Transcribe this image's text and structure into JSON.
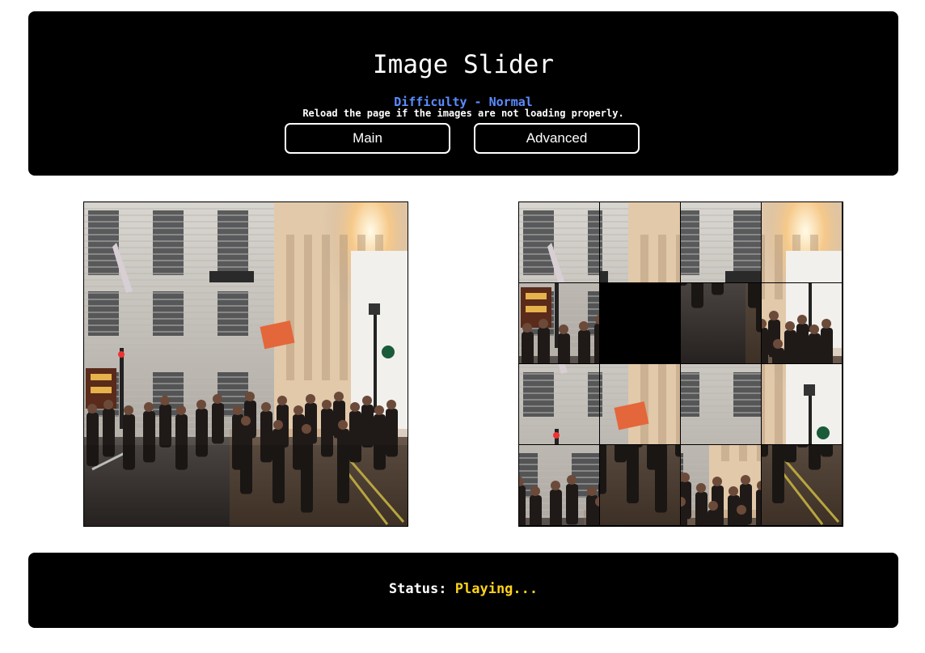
{
  "header": {
    "title": "Image Slider",
    "difficulty": "Difficulty - Normal",
    "reload_note": "Reload the page if the images are not loading properly.",
    "buttons": {
      "main": "Main",
      "advanced": "Advanced"
    }
  },
  "reference_image": {
    "alt": "street-photo"
  },
  "puzzle": {
    "grid_size": 4,
    "empty_tile": 5,
    "tiles": [
      {
        "slot": 0,
        "piece": 0
      },
      {
        "slot": 1,
        "piece": 2
      },
      {
        "slot": 2,
        "piece": 1
      },
      {
        "slot": 3,
        "piece": 3
      },
      {
        "slot": 4,
        "piece": 8
      },
      {
        "slot": 5,
        "piece": null
      },
      {
        "slot": 6,
        "piece": 13
      },
      {
        "slot": 7,
        "piece": 11
      },
      {
        "slot": 8,
        "piece": 4
      },
      {
        "slot": 9,
        "piece": 6
      },
      {
        "slot": 10,
        "piece": 5
      },
      {
        "slot": 11,
        "piece": 7
      },
      {
        "slot": 12,
        "piece": 9
      },
      {
        "slot": 13,
        "piece": 14
      },
      {
        "slot": 14,
        "piece": 10
      },
      {
        "slot": 15,
        "piece": 15
      }
    ]
  },
  "footer": {
    "status_label": "Status:",
    "status_value": "Playing..."
  }
}
